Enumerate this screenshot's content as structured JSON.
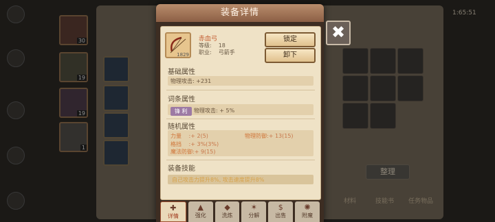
{
  "modal": {
    "title": "装备详情",
    "item": {
      "name": "赤血弓",
      "count": "1829",
      "level_label": "等级:",
      "level": "18",
      "class_label": "职业:",
      "class": "弓箭手"
    },
    "buttons": {
      "lock": "锁定",
      "unequip": "卸下"
    },
    "base_attrs": {
      "title": "基础属性",
      "line": "物理攻击: +231"
    },
    "affix_attrs": {
      "title": "词条属性",
      "tag": "锋 利",
      "line": "物理攻击: + 5%"
    },
    "random_attrs": {
      "title": "随机属性",
      "items": [
        {
          "name": "力量",
          "value": ":+ 2(5)"
        },
        {
          "name": "物理防御:",
          "value": "+ 13(15)"
        },
        {
          "name": "格挡",
          "value": ":+ 3%(3%)"
        },
        {
          "name": "魔法防御:",
          "value": "+ 9(15)"
        }
      ]
    },
    "skill": {
      "title": "装备技能",
      "text": "自己攻击力提升8%, 攻击速度提升8%"
    },
    "close_icon": "✖"
  },
  "tabs": [
    {
      "label": "详情",
      "icon": "✚"
    },
    {
      "label": "强化",
      "icon": "▲"
    },
    {
      "label": "洗炼",
      "icon": "◆"
    },
    {
      "label": "分解",
      "icon": "✶"
    },
    {
      "label": "出售",
      "icon": "$"
    },
    {
      "label": "附魔",
      "icon": "✺"
    }
  ],
  "background": {
    "hero_levels": [
      "30",
      "19",
      "19",
      "1"
    ],
    "right_labels": [
      "材料",
      "技能书",
      "任务物品"
    ],
    "sort_button": "整理",
    "top_right": "1:65:51"
  }
}
